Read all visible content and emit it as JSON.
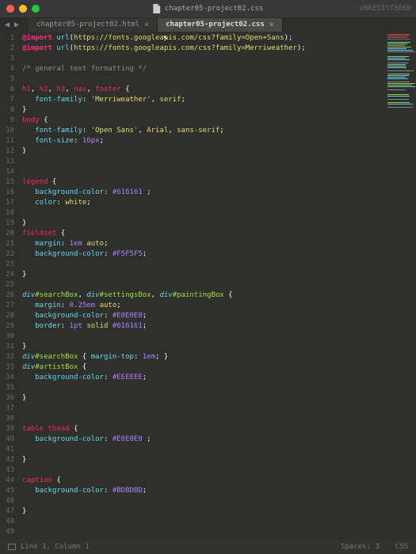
{
  "title": "chapter05-project02.css",
  "unregistered": "UNREGISTERED",
  "tabs": [
    {
      "label": "chapter05-project02.html",
      "active": false
    },
    {
      "label": "chapter05-project02.css",
      "active": true
    }
  ],
  "status": {
    "position": "Line 1, Column 1",
    "spaces": "Spaces: 3",
    "lang": "CSS"
  },
  "code": [
    [
      [
        "kw",
        "@import"
      ],
      [
        "punct",
        " "
      ],
      [
        "fn",
        "url"
      ],
      [
        "punct",
        "("
      ],
      [
        "str",
        "https://fonts.googleapis.com/css?family=Open+Sans"
      ],
      [
        "punct",
        ");"
      ]
    ],
    [
      [
        "kw",
        "@import"
      ],
      [
        "punct",
        " "
      ],
      [
        "fn",
        "url"
      ],
      [
        "punct",
        "("
      ],
      [
        "str",
        "https://fonts.googleapis.com/css?family=Merriweather"
      ],
      [
        "punct",
        ");"
      ]
    ],
    [],
    [
      [
        "cmt",
        "/* general text formatting */"
      ]
    ],
    [],
    [
      [
        "tag",
        "h1"
      ],
      [
        "punct",
        ", "
      ],
      [
        "tag",
        "h2"
      ],
      [
        "punct",
        ", "
      ],
      [
        "tag",
        "h3"
      ],
      [
        "punct",
        ", "
      ],
      [
        "tag",
        "nav"
      ],
      [
        "punct",
        ", "
      ],
      [
        "tag",
        "footer"
      ],
      [
        "punct",
        " {"
      ]
    ],
    [
      [
        "punct",
        "   "
      ],
      [
        "prop",
        "font-family"
      ],
      [
        "punct",
        ": "
      ],
      [
        "val",
        "'Merriweather'"
      ],
      [
        "punct",
        ", "
      ],
      [
        "val",
        "serif"
      ],
      [
        "punct",
        ";"
      ]
    ],
    [
      [
        "punct",
        "}"
      ]
    ],
    [
      [
        "tag",
        "body"
      ],
      [
        "punct",
        " {"
      ]
    ],
    [
      [
        "punct",
        "   "
      ],
      [
        "prop",
        "font-family"
      ],
      [
        "punct",
        ": "
      ],
      [
        "val",
        "'Open Sans'"
      ],
      [
        "punct",
        ", "
      ],
      [
        "val",
        "Arial"
      ],
      [
        "punct",
        ", "
      ],
      [
        "val",
        "sans-serif"
      ],
      [
        "punct",
        ";"
      ]
    ],
    [
      [
        "punct",
        "   "
      ],
      [
        "prop",
        "font-size"
      ],
      [
        "punct",
        ": "
      ],
      [
        "num",
        "16px"
      ],
      [
        "punct",
        ";"
      ]
    ],
    [
      [
        "punct",
        "}"
      ]
    ],
    [],
    [],
    [
      [
        "tag",
        "legend"
      ],
      [
        "punct",
        " {"
      ]
    ],
    [
      [
        "punct",
        "   "
      ],
      [
        "prop",
        "background-color"
      ],
      [
        "punct",
        ": "
      ],
      [
        "hex",
        "#616161"
      ],
      [
        "punct",
        " ;"
      ]
    ],
    [
      [
        "punct",
        "   "
      ],
      [
        "prop",
        "color"
      ],
      [
        "punct",
        ": "
      ],
      [
        "val",
        "white"
      ],
      [
        "punct",
        ";"
      ]
    ],
    [],
    [
      [
        "punct",
        "}"
      ]
    ],
    [
      [
        "tag",
        "fieldset"
      ],
      [
        "punct",
        " {"
      ]
    ],
    [
      [
        "punct",
        "   "
      ],
      [
        "prop",
        "margin"
      ],
      [
        "punct",
        ": "
      ],
      [
        "num",
        "1em"
      ],
      [
        "punct",
        " "
      ],
      [
        "val",
        "auto"
      ],
      [
        "punct",
        ";"
      ]
    ],
    [
      [
        "punct",
        "   "
      ],
      [
        "prop",
        "background-color"
      ],
      [
        "punct",
        ": "
      ],
      [
        "hex",
        "#F5F5F5"
      ],
      [
        "punct",
        ";"
      ]
    ],
    [],
    [
      [
        "punct",
        "}"
      ]
    ],
    [],
    [
      [
        "tagb",
        "div"
      ],
      [
        "sel",
        "#searchBox"
      ],
      [
        "punct",
        ", "
      ],
      [
        "tagb",
        "div"
      ],
      [
        "sel",
        "#settingsBox"
      ],
      [
        "punct",
        ", "
      ],
      [
        "tagb",
        "div"
      ],
      [
        "sel",
        "#paintingBox"
      ],
      [
        "punct",
        " {"
      ]
    ],
    [
      [
        "punct",
        "   "
      ],
      [
        "prop",
        "margin"
      ],
      [
        "punct",
        ": "
      ],
      [
        "num",
        "0.25em"
      ],
      [
        "punct",
        " "
      ],
      [
        "val",
        "auto"
      ],
      [
        "punct",
        ";"
      ]
    ],
    [
      [
        "punct",
        "   "
      ],
      [
        "prop",
        "background-color"
      ],
      [
        "punct",
        ": "
      ],
      [
        "hex",
        "#E0E0E0"
      ],
      [
        "punct",
        ";"
      ]
    ],
    [
      [
        "punct",
        "   "
      ],
      [
        "prop",
        "border"
      ],
      [
        "punct",
        ": "
      ],
      [
        "num",
        "1pt"
      ],
      [
        "punct",
        " "
      ],
      [
        "val",
        "solid"
      ],
      [
        "punct",
        " "
      ],
      [
        "hex",
        "#616161"
      ],
      [
        "punct",
        ";"
      ]
    ],
    [],
    [
      [
        "punct",
        "}"
      ]
    ],
    [
      [
        "tagb",
        "div"
      ],
      [
        "sel",
        "#searchBox"
      ],
      [
        "punct",
        " { "
      ],
      [
        "prop",
        "margin-top"
      ],
      [
        "punct",
        ": "
      ],
      [
        "num",
        "1em"
      ],
      [
        "punct",
        "; }"
      ]
    ],
    [
      [
        "tagb",
        "div"
      ],
      [
        "sel",
        "#artistBox"
      ],
      [
        "punct",
        " {"
      ]
    ],
    [
      [
        "punct",
        "   "
      ],
      [
        "prop",
        "background-color"
      ],
      [
        "punct",
        ": "
      ],
      [
        "hex",
        "#EEEEEE"
      ],
      [
        "punct",
        ";"
      ]
    ],
    [],
    [
      [
        "punct",
        "}"
      ]
    ],
    [],
    [],
    [
      [
        "tag",
        "table"
      ],
      [
        "punct",
        " "
      ],
      [
        "tag",
        "thead"
      ],
      [
        "punct",
        " {"
      ]
    ],
    [
      [
        "punct",
        "   "
      ],
      [
        "prop",
        "background-color"
      ],
      [
        "punct",
        ": "
      ],
      [
        "hex",
        "#E0E0E0"
      ],
      [
        "punct",
        " ;"
      ]
    ],
    [],
    [
      [
        "punct",
        "}"
      ]
    ],
    [],
    [
      [
        "tag",
        "caption"
      ],
      [
        "punct",
        " {"
      ]
    ],
    [
      [
        "punct",
        "   "
      ],
      [
        "prop",
        "background-color"
      ],
      [
        "punct",
        ": "
      ],
      [
        "hex",
        "#BDBDBD"
      ],
      [
        "punct",
        ";"
      ]
    ],
    [],
    [
      [
        "punct",
        "}"
      ]
    ],
    [],
    []
  ],
  "minimap_colors": [
    "#d44",
    "#d44",
    "#666",
    "#666",
    "",
    "#9c4",
    "#6cf",
    "#888",
    "#9c4",
    "#6cf",
    "#6cf",
    "#888",
    "",
    "",
    "#9c4",
    "#6cf",
    "#6cf",
    "",
    "#888",
    "#9c4",
    "#6cf",
    "#6cf",
    "",
    "#888",
    "",
    "#9c4",
    "#6cf",
    "#6cf",
    "#6cf",
    "",
    "#888",
    "#9c4",
    "#9c4",
    "#6cf",
    "",
    "#888",
    "",
    "",
    "#9c4",
    "#6cf",
    "",
    "#888",
    "",
    "#9c4",
    "#6cf",
    "",
    "#888"
  ]
}
